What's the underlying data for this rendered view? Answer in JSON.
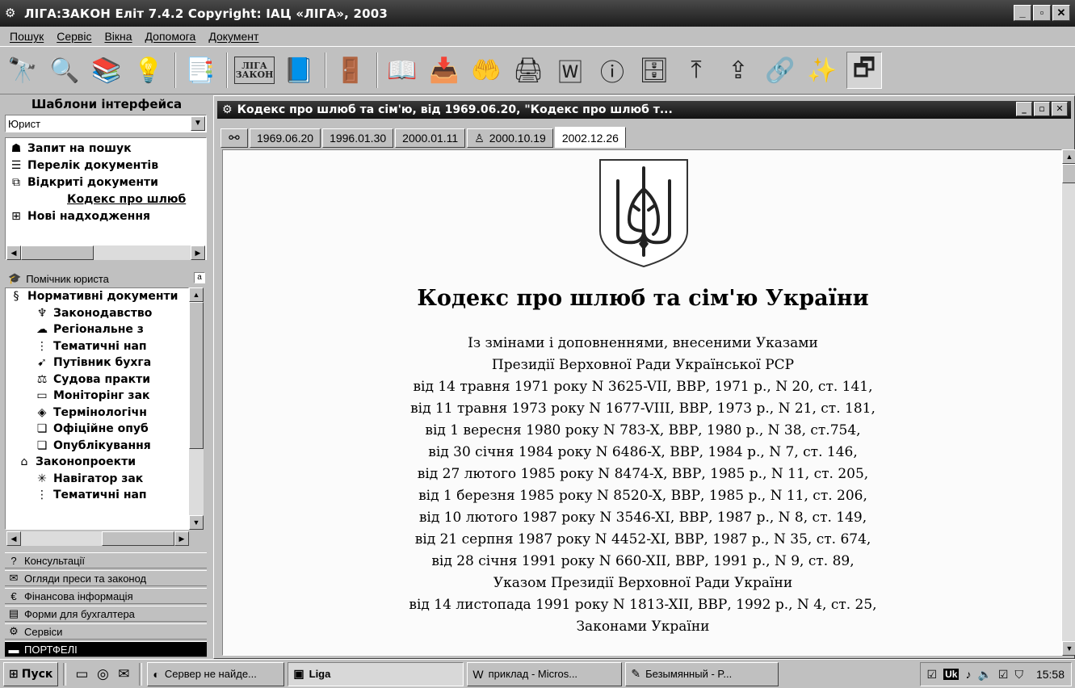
{
  "app": {
    "title": "ЛІГА:ЗАКОН Еліт 7.4.2 Copyright: ІАЦ «ЛІГА», 2003",
    "window_buttons": [
      "_",
      "▫",
      "✕"
    ]
  },
  "menu": [
    "Пошук",
    "Сервіс",
    "Вікна",
    "Допомога",
    "Документ"
  ],
  "toolbar": {
    "icons": [
      "binoculars-icon",
      "magnifier-icon",
      "books-icon",
      "lightbulb-icon",
      "pages-icon",
      "liga-zakon-logo",
      "help-book-icon",
      "exit-door-icon",
      "open-book-icon",
      "download-books-icon",
      "book-hand-icon",
      "printer-icon",
      "word-doc-icon",
      "info-icon",
      "bookshelf-icon",
      "up-arrow-doc-icon",
      "export-doc-icon",
      "chain-link-icon",
      "magic-wand-icon",
      "window-toggle-icon"
    ],
    "logo_line1": "ЛІГА",
    "logo_line2": "ЗАКОН",
    "glyphs": [
      "🔭",
      "🔍",
      "📚",
      "💡",
      "📑",
      "",
      "📘",
      "🚪",
      "📖",
      "📥",
      "🤲",
      "🖨",
      "🅆",
      "ⓘ",
      "🗄",
      "⤒",
      "⇪",
      "🔗",
      "✨",
      "🗗"
    ]
  },
  "left_panel": {
    "templates_label": "Шаблони інтерфейса",
    "profile_value": "Юрист",
    "top_tree": [
      {
        "icon": "☗",
        "label": "Запит на пошук",
        "type": "item"
      },
      {
        "icon": "☰",
        "label": "Перелік документів",
        "type": "item"
      },
      {
        "icon": "⧉",
        "label": "Відкриті документи",
        "type": "item"
      },
      {
        "icon": "",
        "label": "Кодекс про шлюб",
        "type": "link"
      },
      {
        "icon": "⊞",
        "label": "Нові надходження",
        "type": "item"
      }
    ],
    "helper_label": "Помічник юриста",
    "helper_tree": [
      {
        "icon": "§",
        "label": "Нормативні документи",
        "indent": 0
      },
      {
        "icon": "♆",
        "label": "Законодавство",
        "indent": 1
      },
      {
        "icon": "☁",
        "label": "Регіональне з",
        "indent": 1
      },
      {
        "icon": "⋮",
        "label": "Тематичні нап",
        "indent": 1
      },
      {
        "icon": "➹",
        "label": "Путівник бухга",
        "indent": 1
      },
      {
        "icon": "⚖",
        "label": "Судова практи",
        "indent": 1
      },
      {
        "icon": "▭",
        "label": "Моніторінг зак",
        "indent": 1
      },
      {
        "icon": "◈",
        "label": "Термінологічн",
        "indent": 1
      },
      {
        "icon": "❏",
        "label": "Офіційне опуб",
        "indent": 1
      },
      {
        "icon": "❏",
        "label": "Опублікування",
        "indent": 1
      },
      {
        "icon": "⌂",
        "label": "Законопроекти",
        "indent": 0
      },
      {
        "icon": "✳",
        "label": "Навігатор зак",
        "indent": 1
      },
      {
        "icon": "⋮",
        "label": "Тематичні нап",
        "indent": 1
      }
    ],
    "sections": [
      {
        "icon": "?",
        "label": "Консультації"
      },
      {
        "icon": "✉",
        "label": "Огляди преси та законод"
      },
      {
        "icon": "€",
        "label": "Фінансова інформація"
      },
      {
        "icon": "▤",
        "label": "Форми для бухгалтера"
      },
      {
        "icon": "⚙",
        "label": "Сервіси"
      },
      {
        "icon": "▬",
        "label": "ПОРТФЕЛІ"
      }
    ]
  },
  "document": {
    "window_title": "Кодекс про шлюб та сім'ю, від 1969.06.20, \"Кодекс про шлюб т...",
    "tabs": [
      "1969.06.20",
      "1996.01.30",
      "2000.01.11",
      "2000.10.19",
      "2002.12.26"
    ],
    "active_tab": "2002.12.26",
    "heading": "Кодекс про шлюб та сім'ю України",
    "lines": [
      "Із змінами і доповненнями, внесеними Указами",
      "Президії Верховної Ради Української РСР",
      "від 14 травня 1971 року N 3625-VII, ВВР, 1971 р., N 20, ст. 141,",
      "від 11 травня 1973 року N 1677-VIII, ВВР, 1973 р., N 21, ст. 181,",
      "від 1 вересня 1980 року N 783-X, ВВР, 1980 р., N 38, ст.754,",
      "від 30 січня 1984 року N 6486-X, ВВР, 1984 р., N 7, ст. 146,",
      "від 27 лютого 1985 року N 8474-X, ВВР, 1985 р., N 11, ст. 205,",
      "від 1 березня 1985 року N 8520-X, ВВР, 1985 р., N 11, ст. 206,",
      "від 10 лютого 1987 року N 3546-XI, ВВР, 1987 р., N 8, ст. 149,",
      "від 21 серпня 1987 року N 4452-XI, ВВР, 1987 р., N 35, ст. 674,",
      "від 28 січня 1991 року N 660-XII, ВВР, 1991 р., N 9, ст. 89,",
      "Указом Президії Верховної Ради України",
      "від 14 листопада 1991 року N 1813-XII, ВВР, 1992 р., N 4, ст. 25,",
      "Законами України"
    ]
  },
  "taskbar": {
    "start_label": "Пуск",
    "tasks": [
      {
        "icon": "◐",
        "label": "Сервер не найде...",
        "active": false
      },
      {
        "icon": "▣",
        "label": "Liga",
        "active": true
      },
      {
        "icon": "W",
        "label": "приклад - Micros...",
        "active": false
      },
      {
        "icon": "✎",
        "label": "Безымянный - P...",
        "active": false
      }
    ],
    "tray_lang": "Uk",
    "clock": "15:58"
  }
}
